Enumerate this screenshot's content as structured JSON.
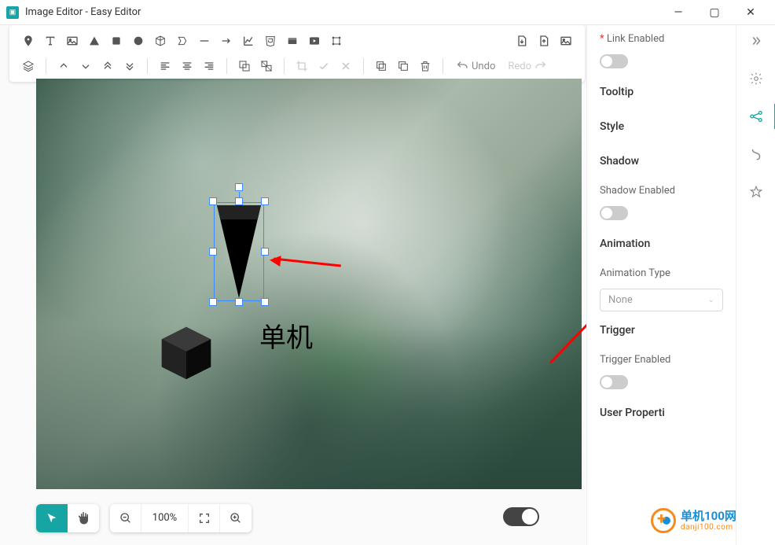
{
  "window": {
    "title": "Image Editor - Easy Editor"
  },
  "toolbar": {
    "undo_label": "Undo",
    "redo_label": "Redo"
  },
  "canvas": {
    "text_label": "单机",
    "zoom_label": "100%"
  },
  "panel": {
    "link_enabled": "Link Enabled",
    "tooltip": "Tooltip",
    "style": "Style",
    "shadow": "Shadow",
    "shadow_enabled": "Shadow Enabled",
    "animation": "Animation",
    "animation_type": "Animation Type",
    "animation_value": "None",
    "trigger": "Trigger",
    "trigger_enabled": "Trigger Enabled",
    "user_properties": "User Properti"
  },
  "watermark": {
    "cn": "单机100网",
    "en": "danji100.com"
  }
}
